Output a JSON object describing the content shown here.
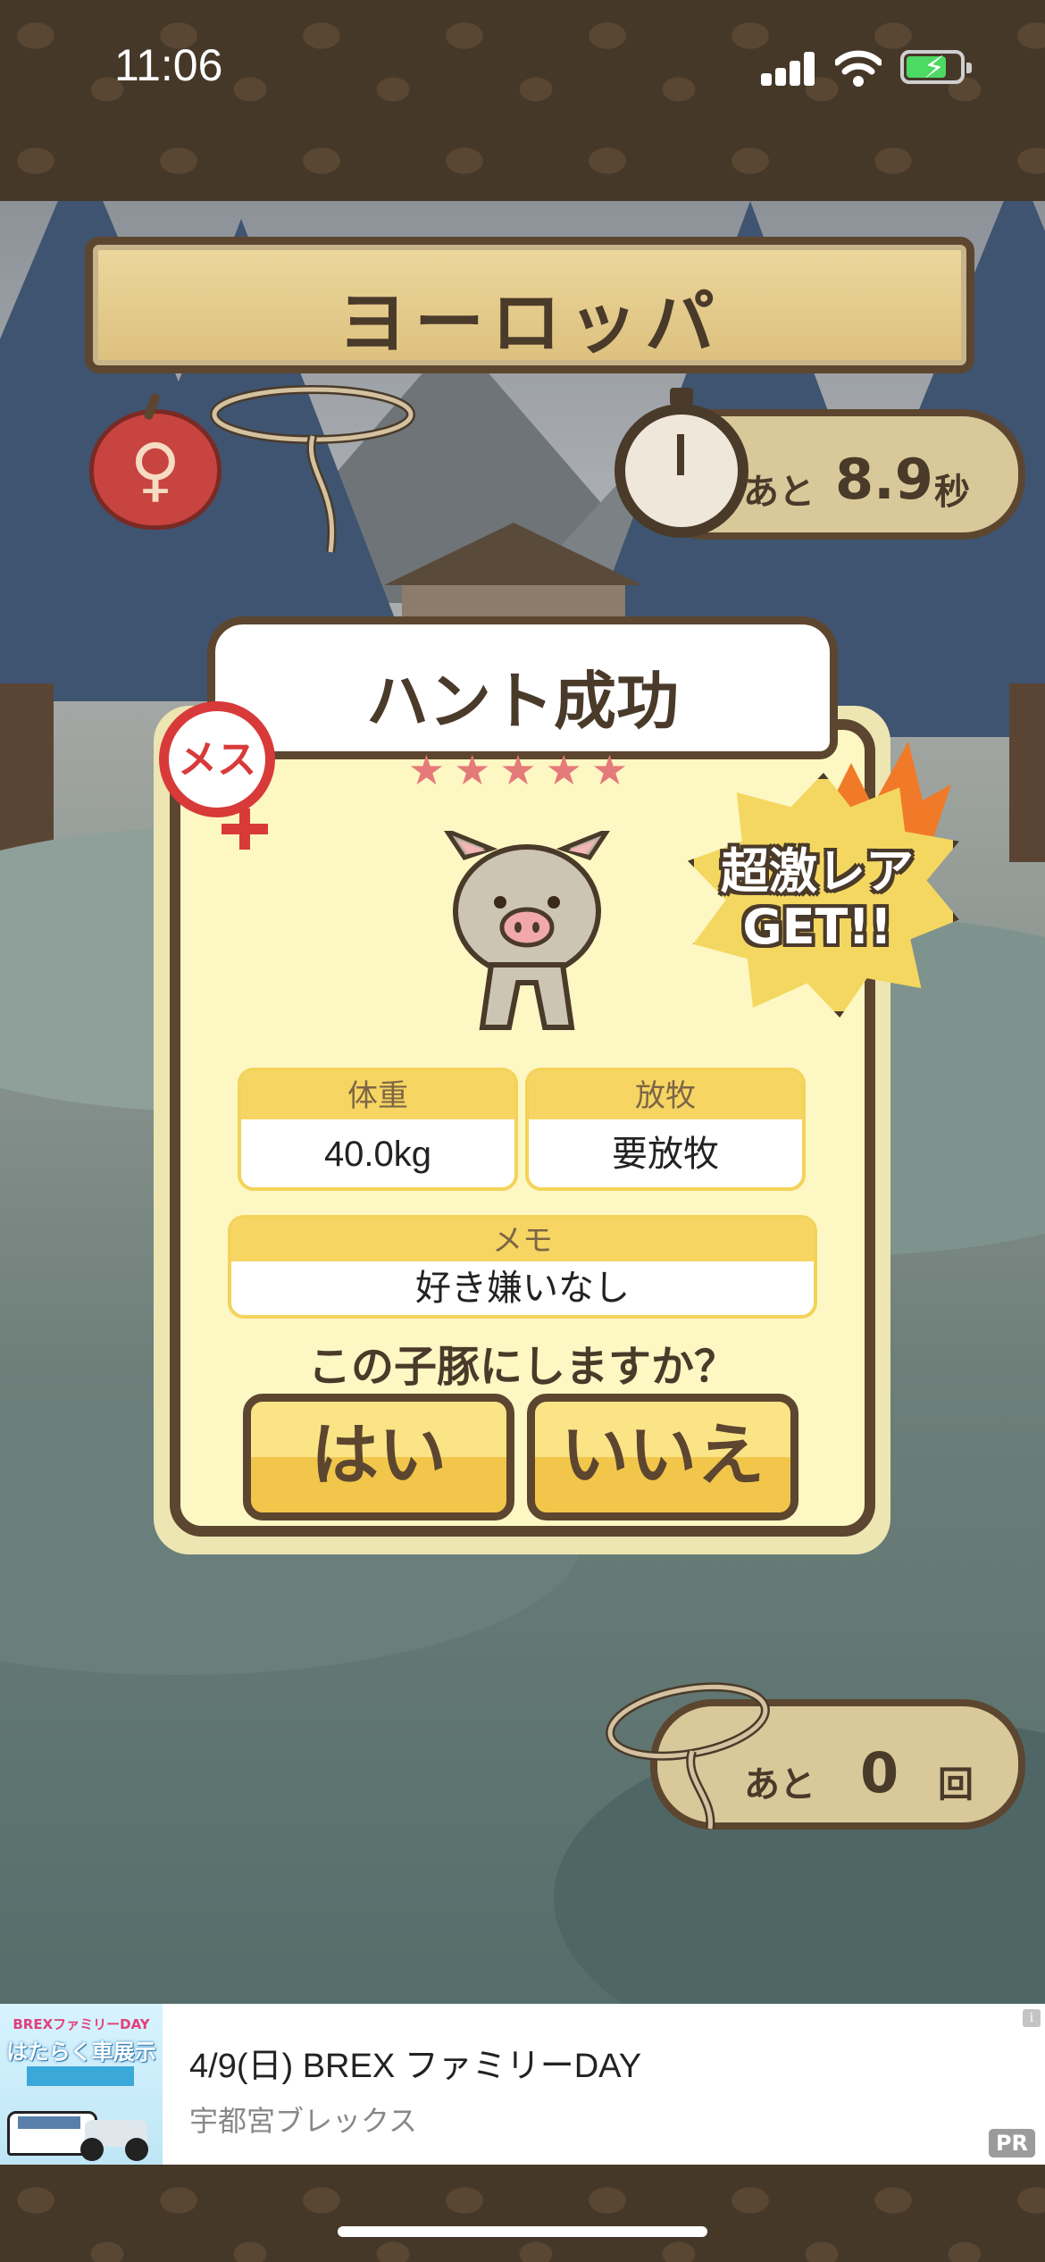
{
  "status_bar": {
    "time": "11:06"
  },
  "header": {
    "region": "ヨーロッパ"
  },
  "timer": {
    "label": "あと",
    "value": "8.9",
    "unit": "秒"
  },
  "result_card": {
    "title": "ハント成功",
    "stars": "★★★★★",
    "gender_badge": "メス",
    "rarity_burst": [
      "超激レア",
      "GET!!"
    ],
    "weight": {
      "label": "体重",
      "value": "40.0kg"
    },
    "grazing": {
      "label": "放牧",
      "value": "要放牧"
    },
    "memo": {
      "label": "メモ",
      "value": "好き嫌いなし"
    },
    "question": "この子豚にしますか？",
    "yes_label": "はい",
    "no_label": "いいえ"
  },
  "lasso": {
    "label": "あと",
    "value": "0",
    "unit": "回"
  },
  "ad": {
    "title": "4/9(日) BREX ファミリーDAY",
    "advertiser": "宇都宮ブレックス",
    "badge": "PR",
    "info": "i",
    "thumb_lines": [
      "BREXファミリーDAY",
      "はたらく車展示"
    ]
  },
  "colors": {
    "wood": "#5c4630",
    "card": "#fdf7c3",
    "accent": "#f6d562",
    "female": "#d83a3a"
  }
}
